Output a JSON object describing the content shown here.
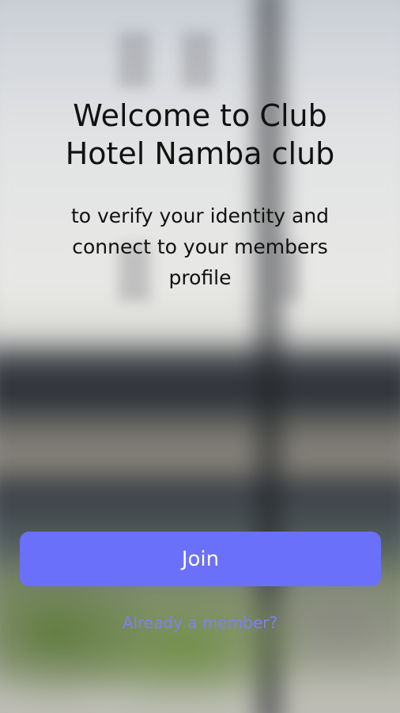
{
  "screen": {
    "background": "blurred-hotel-photo"
  },
  "welcome": {
    "title_line1": "Welcome to Club",
    "title_line2": "Hotel Namba club",
    "subtitle_line1": "to verify your identity and",
    "subtitle_line2": "connect to your members",
    "subtitle_line3": "profile"
  },
  "actions": {
    "join_label": "Join",
    "member_link_label": "Already a member?"
  },
  "colors": {
    "accent": "#6b70fa",
    "link": "#7d80f4",
    "text": "#111111"
  }
}
